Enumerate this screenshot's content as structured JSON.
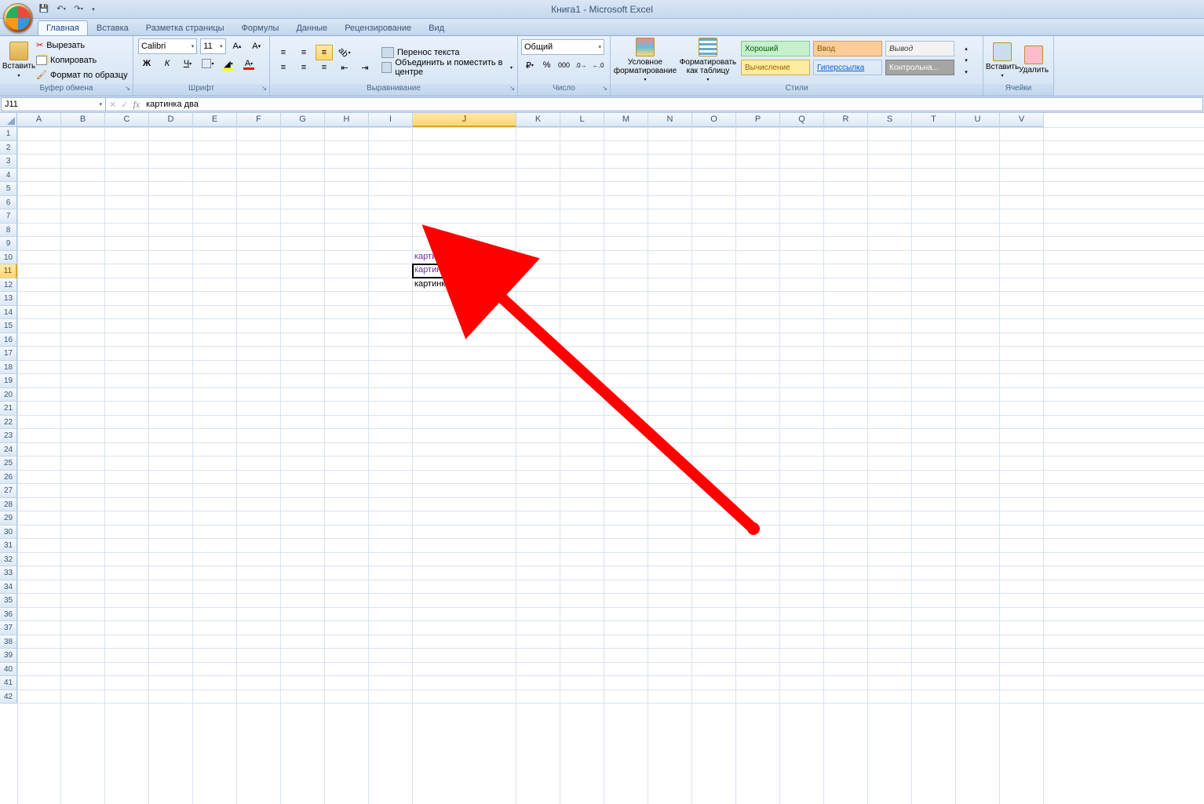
{
  "app": {
    "title": "Книга1 - Microsoft Excel"
  },
  "qat": {
    "save": "💾",
    "undo": "↶",
    "redo": "↷"
  },
  "tabs": [
    "Главная",
    "Вставка",
    "Разметка страницы",
    "Формулы",
    "Данные",
    "Рецензирование",
    "Вид"
  ],
  "active_tab": 0,
  "ribbon": {
    "clipboard": {
      "label": "Буфер обмена",
      "paste": "Вставить",
      "cut": "Вырезать",
      "copy": "Копировать",
      "format_painter": "Формат по образцу"
    },
    "font": {
      "label": "Шрифт",
      "name": "Calibri",
      "size": "11",
      "bold": "Ж",
      "italic": "К",
      "underline": "Ч"
    },
    "alignment": {
      "label": "Выравнивание",
      "wrap": "Перенос текста",
      "merge": "Объединить и поместить в центре"
    },
    "number": {
      "label": "Число",
      "format": "Общий"
    },
    "styles": {
      "label": "Стили",
      "cond": "Условное форматирование",
      "table": "Форматировать как таблицу",
      "good": "Хороший",
      "input": "Ввод",
      "output": "Вывод",
      "calc": "Вычисление",
      "link": "Гиперссылка",
      "check": "Контрольна..."
    },
    "cells": {
      "label": "Ячейки",
      "insert": "Вставить",
      "delete": "Удалить"
    }
  },
  "formula_bar": {
    "cell_ref": "J11",
    "value": "картинка два",
    "fx": "fx"
  },
  "columns": [
    "A",
    "B",
    "C",
    "D",
    "E",
    "F",
    "G",
    "H",
    "I",
    "J",
    "K",
    "L",
    "M",
    "N",
    "O",
    "P",
    "Q",
    "R",
    "S",
    "T",
    "U",
    "V"
  ],
  "active_col_index": 9,
  "row_count": 42,
  "active_row": 11,
  "col_widths": {
    "default": 56,
    "J": 132
  },
  "cell_data": {
    "J10": {
      "text": "картинка один",
      "kind": "link"
    },
    "J11": {
      "text": "картинка два",
      "kind": "link"
    },
    "J12": {
      "text": "картинка три",
      "kind": "text"
    }
  },
  "selected_cell": "J11"
}
